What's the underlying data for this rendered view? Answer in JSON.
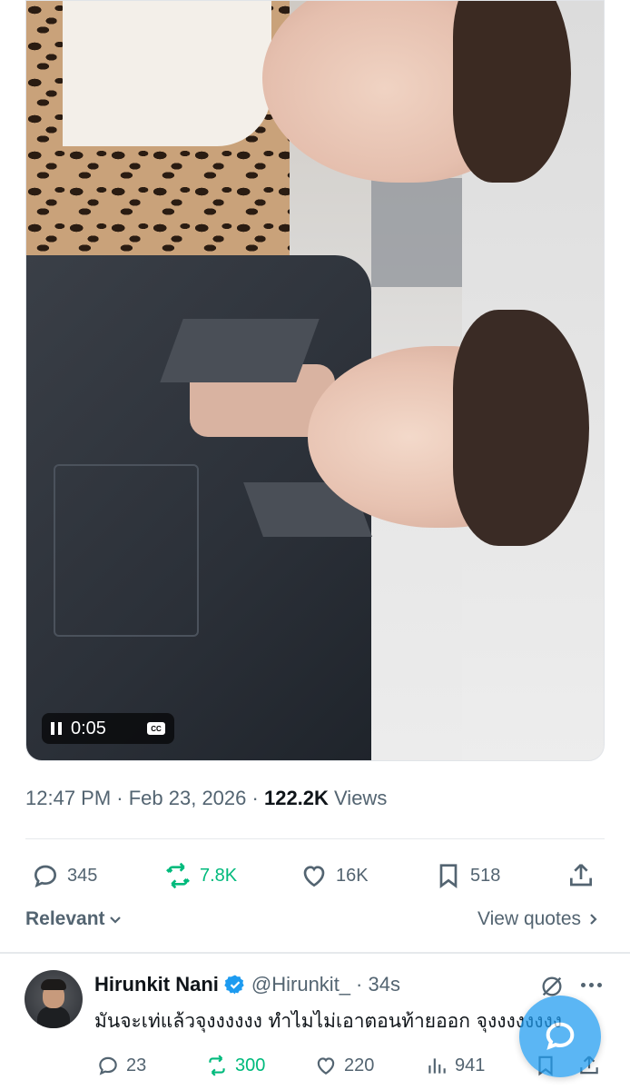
{
  "video": {
    "time": "0:05",
    "cc_label": "CC"
  },
  "tweet_meta": {
    "time": "12:47 PM",
    "separator1": " · ",
    "date": "Feb 23, 2026",
    "separator2": " · ",
    "views_count": "122.2K",
    "views_label": " Views"
  },
  "actions": {
    "replies": "345",
    "reposts": "7.8K",
    "likes": "16K",
    "bookmarks": "518"
  },
  "sort": {
    "label": "Relevant",
    "view_quotes": "View quotes"
  },
  "reply": {
    "name": "Hirunkit Nani",
    "handle": "@Hirunkit_",
    "time": "· 34s",
    "text": "มันจะเท่แล้วจุงงงงงง ทำไมไม่เอาตอนท้ายออก จุงงงงงงงง",
    "replies": "23",
    "reposts": "300",
    "likes": "220",
    "views": "941"
  },
  "colors": {
    "accent": "#1d9bf0",
    "repost_green": "#00ba7c",
    "muted_text": "#536471"
  },
  "icons": [
    "pause-icon",
    "cc-icon",
    "reply-icon",
    "repost-icon",
    "like-icon",
    "bookmark-icon",
    "share-icon",
    "chevron-down-icon",
    "chevron-right-icon",
    "verified-badge-icon",
    "grok-icon",
    "more-icon",
    "views-icon",
    "compose-icon"
  ]
}
